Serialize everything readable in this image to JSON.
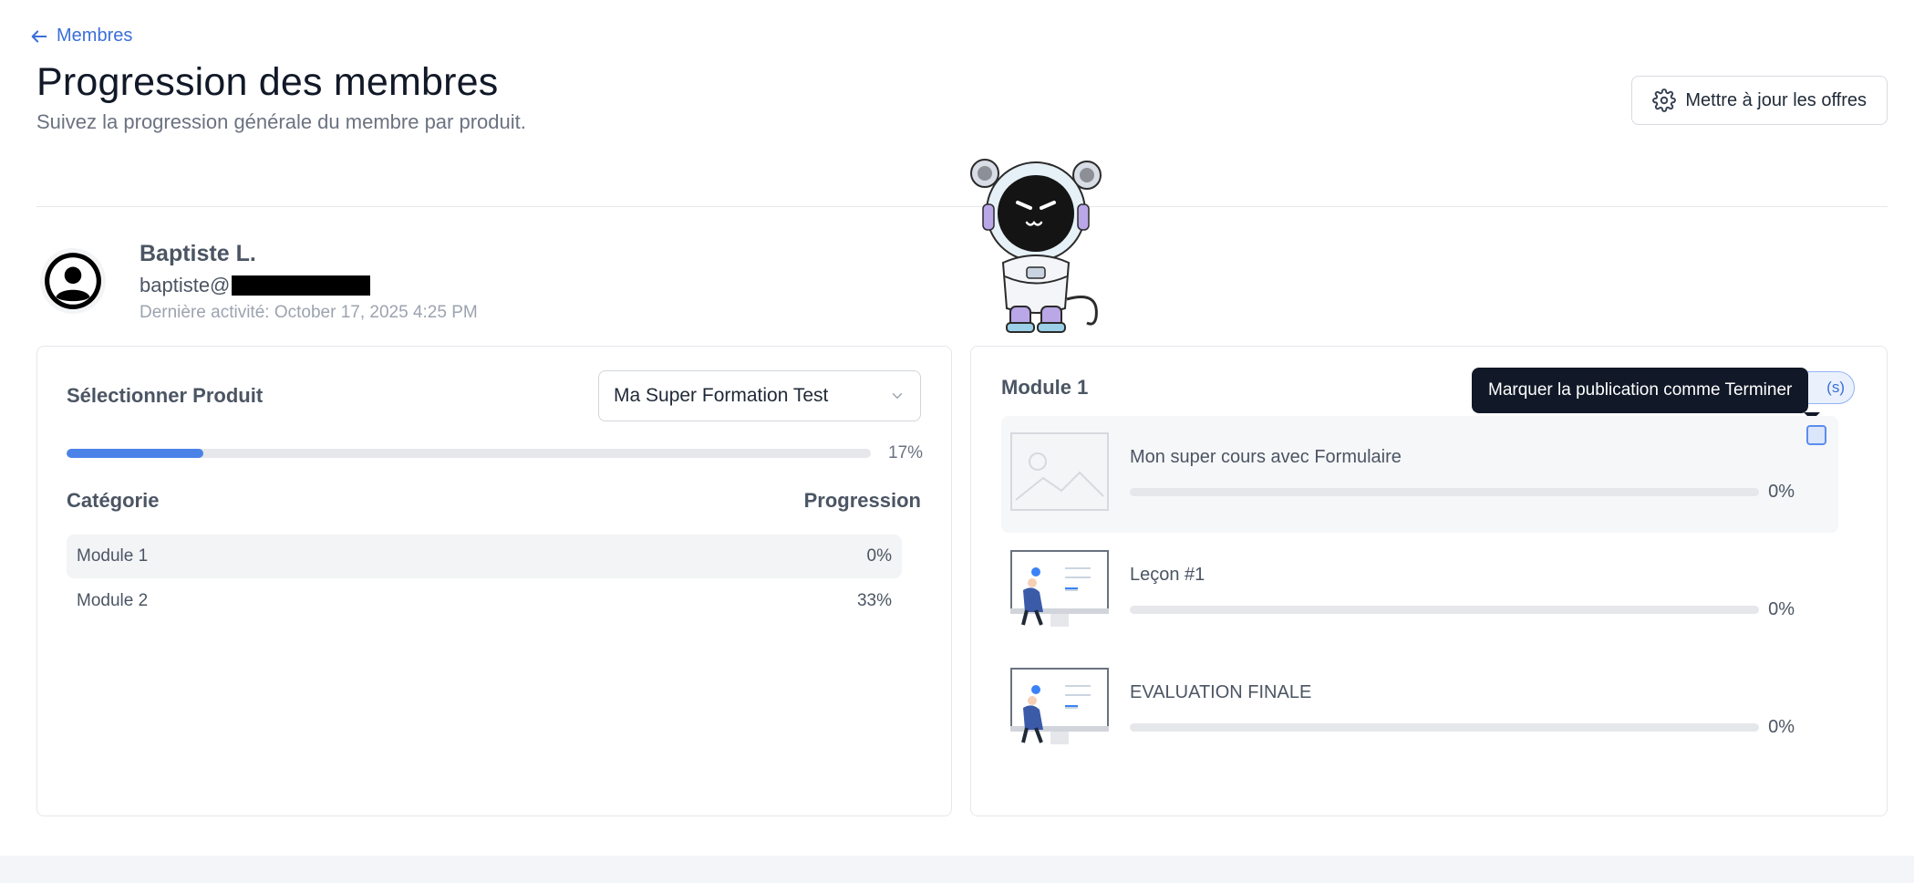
{
  "header": {
    "back_label": "Membres",
    "title": "Progression des membres",
    "subtitle": "Suivez la progression générale du membre par produit.",
    "update_button": "Mettre à jour les offres"
  },
  "member": {
    "name": "Baptiste L.",
    "email_visible": "baptiste@",
    "last_activity": "Dernière activité: October 17, 2025 4:25 PM"
  },
  "product_panel": {
    "select_label": "Sélectionner Produit",
    "selected_product": "Ma Super Formation Test",
    "overall_progress": 17,
    "overall_progress_text": "17%",
    "col_category": "Catégorie",
    "col_progress": "Progression",
    "categories": [
      {
        "name": "Module 1",
        "progress": "0%"
      },
      {
        "name": "Module 2",
        "progress": "33%"
      }
    ]
  },
  "module_panel": {
    "title": "Module 1",
    "badge_text": "(s)",
    "tooltip": "Marquer la publication comme Terminer",
    "lessons": [
      {
        "title": "Mon super cours avec Formulaire",
        "progress": 0,
        "progress_text": "0%",
        "thumbnail": "placeholder-image-icon"
      },
      {
        "title": "Leçon #1",
        "progress": 0,
        "progress_text": "0%",
        "thumbnail": "presentation-illustration"
      },
      {
        "title": "EVALUATION FINALE",
        "progress": 0,
        "progress_text": "0%",
        "thumbnail": "presentation-illustration"
      }
    ]
  },
  "colors": {
    "accent": "#4a82e8",
    "link": "#3b6fd8",
    "tooltip_bg": "#111827"
  }
}
